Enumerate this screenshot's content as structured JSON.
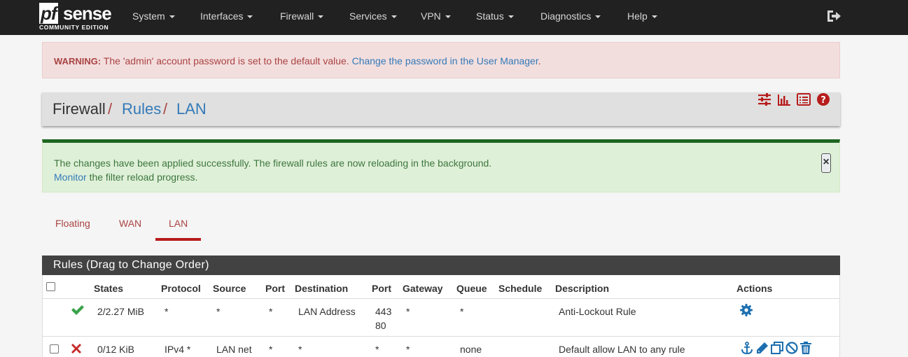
{
  "brand": {
    "logo_pf": "pf",
    "logo_sense": "sense",
    "edition": "COMMUNITY EDITION"
  },
  "nav": {
    "items": [
      "System",
      "Interfaces",
      "Firewall",
      "Services",
      "VPN",
      "Status",
      "Diagnostics",
      "Help"
    ],
    "logout_icon": "sign-out-icon"
  },
  "warning": {
    "label": "WARNING:",
    "text": " The 'admin' account password is set to the default value. ",
    "link": "Change the password in the User Manager",
    "end": "."
  },
  "breadcrumb": {
    "root": "Firewall",
    "sep": "/",
    "level2": "Rules",
    "level3": "LAN",
    "icons": [
      "sliders-icon",
      "bar-chart-icon",
      "list-icon",
      "help-icon"
    ]
  },
  "success": {
    "line1": "The changes have been applied successfully. The firewall rules are now reloading in the background.",
    "monitor_link": "Monitor",
    "line2_rest": " the filter reload progress.",
    "close": "×"
  },
  "tabs": [
    {
      "label": "Floating",
      "active": false
    },
    {
      "label": "WAN",
      "active": false
    },
    {
      "label": "LAN",
      "active": true
    }
  ],
  "panel": {
    "title": "Rules (Drag to Change Order)",
    "columns": [
      "States",
      "Protocol",
      "Source",
      "Port",
      "Destination",
      "Port",
      "Gateway",
      "Queue",
      "Schedule",
      "Description",
      "Actions"
    ]
  },
  "rows": [
    {
      "status_icon": "check-icon",
      "states": "2/2.27 MiB",
      "protocol": "*",
      "source": "*",
      "source_port": "*",
      "destination": "LAN Address",
      "dest_port_1": "443",
      "dest_port_2": "80",
      "gateway": "*",
      "queue": "*",
      "schedule": "",
      "description": "Anti-Lockout Rule",
      "actions": [
        "gear-icon"
      ]
    },
    {
      "status_icon": "times-icon",
      "states": "0/12 KiB",
      "protocol": "IPv4 *",
      "source": "LAN net",
      "source_port": "*",
      "destination": "*",
      "dest_port_1": "*",
      "gateway": "*",
      "queue": "none",
      "schedule": "",
      "description": "Default allow LAN to any rule",
      "actions": [
        "anchor-icon",
        "pencil-icon",
        "copy-icon",
        "ban-icon",
        "trash-icon"
      ]
    }
  ],
  "colors": {
    "navbar": "#212121",
    "accent_red": "#a94442",
    "link_blue": "#337ab7",
    "success_green": "#1e6620",
    "icon_blue": "#1c6fb0"
  }
}
